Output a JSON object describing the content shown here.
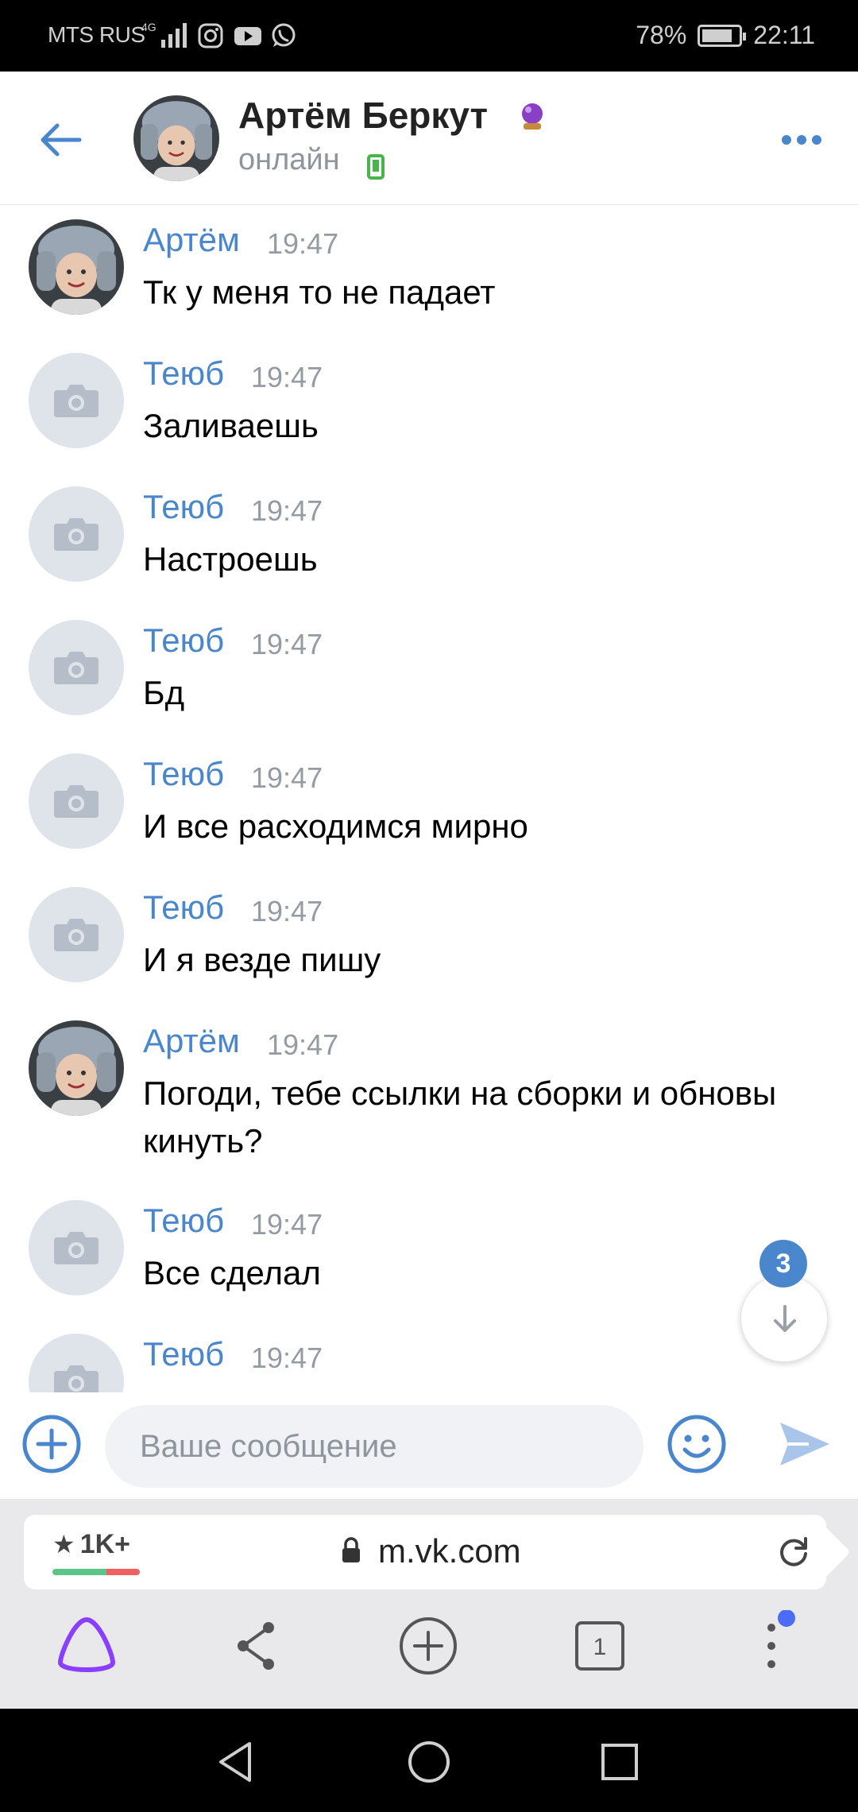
{
  "status_bar": {
    "carrier": "MTS RUS",
    "network": "4G",
    "battery": "78%",
    "battery_level": 0.78,
    "time": "22:11"
  },
  "header": {
    "contact_name": "Артём Беркут",
    "status": "онлайн",
    "back_icon": "arrow-left-icon",
    "more_icon": "more-dots-icon"
  },
  "messages": [
    {
      "author": "Артём",
      "time": "19:47",
      "text": "Тк у меня то не падает",
      "avatar": "photo"
    },
    {
      "author": "Теюб",
      "time": "19:47",
      "text": "Заливаешь",
      "avatar": "camera-placeholder"
    },
    {
      "author": "Теюб",
      "time": "19:47",
      "text": "Настроешь",
      "avatar": "camera-placeholder"
    },
    {
      "author": "Теюб",
      "time": "19:47",
      "text": "Бд",
      "avatar": "camera-placeholder"
    },
    {
      "author": "Теюб",
      "time": "19:47",
      "text": "И все расходимся мирно",
      "avatar": "camera-placeholder"
    },
    {
      "author": "Теюб",
      "time": "19:47",
      "text": "И я везде пишу",
      "avatar": "camera-placeholder"
    },
    {
      "author": "Артём",
      "time": "19:47",
      "text": "Погоди, тебе ссылки на сборки и обновы кинуть?",
      "avatar": "photo"
    },
    {
      "author": "Теюб",
      "time": "19:47",
      "text": "Все сделал",
      "avatar": "camera-placeholder"
    },
    {
      "author": "Теюб",
      "time": "19:47",
      "text": "",
      "avatar": "camera-placeholder"
    }
  ],
  "scroll_down": {
    "unread_count": "3"
  },
  "composer": {
    "placeholder": "Ваше сообщение",
    "value": ""
  },
  "browser": {
    "rating": "1K+",
    "url": "m.vk.com"
  },
  "colors": {
    "accent": "#4986cc",
    "online_green": "#4bb34b",
    "muted": "#959ba3",
    "alice_purple": "#8a3ffc"
  }
}
